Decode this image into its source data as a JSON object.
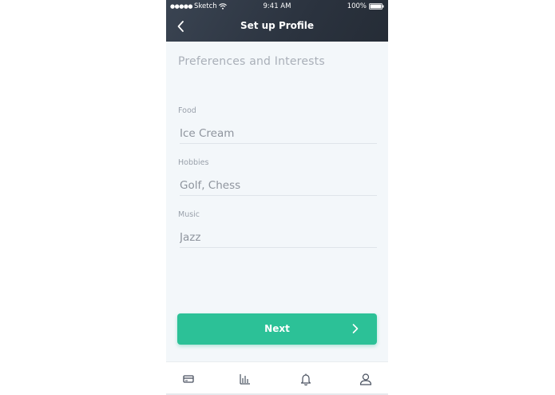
{
  "status_bar": {
    "carrier": "Sketch",
    "signal": "●●●●●",
    "time": "9:41 AM",
    "battery": "100%"
  },
  "header": {
    "title": "Set up Profile",
    "back_icon": "chevron-left-icon"
  },
  "section": {
    "title": "Preferences and Interests"
  },
  "fields": [
    {
      "label": "Food",
      "value": "Ice Cream"
    },
    {
      "label": "Hobbies",
      "value": "Golf, Chess"
    },
    {
      "label": "Music",
      "value": "Jazz"
    }
  ],
  "next_button": {
    "label": "Next",
    "icon": "chevron-right-icon"
  },
  "tab_bar": {
    "items": [
      "card-icon",
      "chart-icon",
      "bell-icon",
      "user-icon"
    ]
  },
  "colors": {
    "header_bg": "#2b333f",
    "accent": "#2cc197",
    "background": "#f3f7fa"
  }
}
